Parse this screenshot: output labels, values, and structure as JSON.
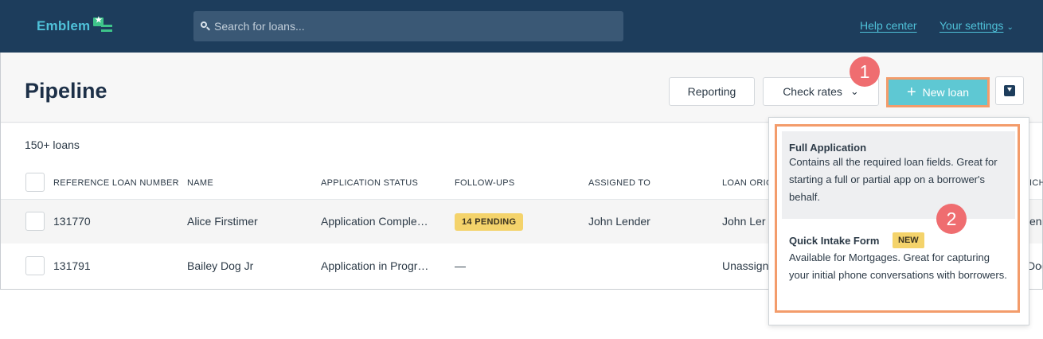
{
  "app": {
    "logo_text": "Emblem"
  },
  "search": {
    "placeholder": "Search for loans..."
  },
  "topnav": {
    "help": "Help center",
    "settings": "Your settings"
  },
  "page": {
    "title": "Pipeline"
  },
  "toolbar": {
    "reporting": "Reporting",
    "check_rates": "Check rates",
    "new_loan": "New loan"
  },
  "callouts": {
    "one": "1",
    "two": "2"
  },
  "table": {
    "count": "150+ loans",
    "columns": [
      "REFERENCE LOAN NUMBER",
      "NAME",
      "APPLICATION STATUS",
      "FOLLOW-UPS",
      "ASSIGNED TO",
      "LOAN ORIG"
    ],
    "rows": [
      {
        "ref": "131770",
        "name": "Alice Firstimer",
        "status": "Application Comple…",
        "followups": "14 PENDING",
        "assigned": "John Lender",
        "originator": "John Ler",
        "edge": "end"
      },
      {
        "ref": "131791",
        "name": "Bailey Dog Jr",
        "status": "Application in Progr…",
        "followups": "—",
        "assigned": "",
        "originator": "Unassign",
        "edge": "Dog"
      }
    ],
    "edge_header": "ICH"
  },
  "menu": {
    "full_title": "Full Application",
    "full_desc": "Contains all the required loan fields. Great for starting a full or partial app on a borrower's behalf.",
    "quick_title": "Quick Intake Form",
    "quick_badge": "NEW",
    "quick_desc": "Available for Mortgages. Great for capturing your initial phone conversations with borrowers."
  },
  "colors": {
    "nav_bg": "#1d3d5c",
    "accent": "#4fc1d8",
    "primary_button": "#5ec8d3",
    "highlight_border": "#f39c6b",
    "callout": "#ef6d70",
    "badge": "#f4d36b"
  }
}
